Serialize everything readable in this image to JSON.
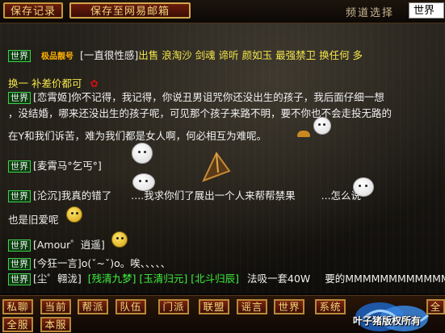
{
  "toolbar": {
    "save_log": "保存记录",
    "save_mail": "保存至网易邮箱",
    "channel_label": "频道选择",
    "channel_value": "世界"
  },
  "messages": [
    {
      "tag": "世界",
      "title": "极品靓号",
      "text1": "[一直很性感]",
      "text2": "出售 浪淘沙 剑魂 谛听 颜如玉 最强禁卫  换任何 多",
      "text3": "换一 补差价都可"
    },
    {
      "tag": "世界",
      "text1": "[恋霄姬]你不记得，我记得，你说丑男诅咒你还没出生的孩子，我后面仔细一想",
      "text2": "，没结婚，哪来还没出生的孩子呢，可见那个孩子来路不明，要不你也不会走投无路的",
      "text3": "在Y和我们诉苦，难为我们都是女人啊，何必相互为难呢。"
    },
    {
      "tag": "世界",
      "text1": "[麦霄马°乞丐°]"
    },
    {
      "tag": "世界",
      "text1": "[沦沉]我真的错了",
      "text2": "....我求你们了展出一个人来帮帮禁果",
      "text3": "...怎么说",
      "text4": "也是旧爱呢"
    },
    {
      "tag": "世界",
      "text1": "[Amour゜逍遥]"
    },
    {
      "tag": "世界",
      "text1": "[今狂一言]o(ˇ~ˇ)o。唉、、、、、"
    },
    {
      "tag": "世界",
      "text1": "[尘゜翱泷]",
      "text2": "[残清九梦]",
      "text3": "[玉清归元]",
      "text4": "[北斗归辰]",
      "text5": "法吸一套40W",
      "text6": "要的MMMMMMMMMMMMMM"
    }
  ],
  "channels": {
    "row1": [
      "私聊",
      "当前",
      "帮派",
      "队伍",
      "门派",
      "联盟",
      "谣言",
      "世界",
      "系统",
      "",
      "全"
    ],
    "row2": [
      "全服",
      "本服"
    ]
  },
  "logo_text": "叶子猪版权所有"
}
